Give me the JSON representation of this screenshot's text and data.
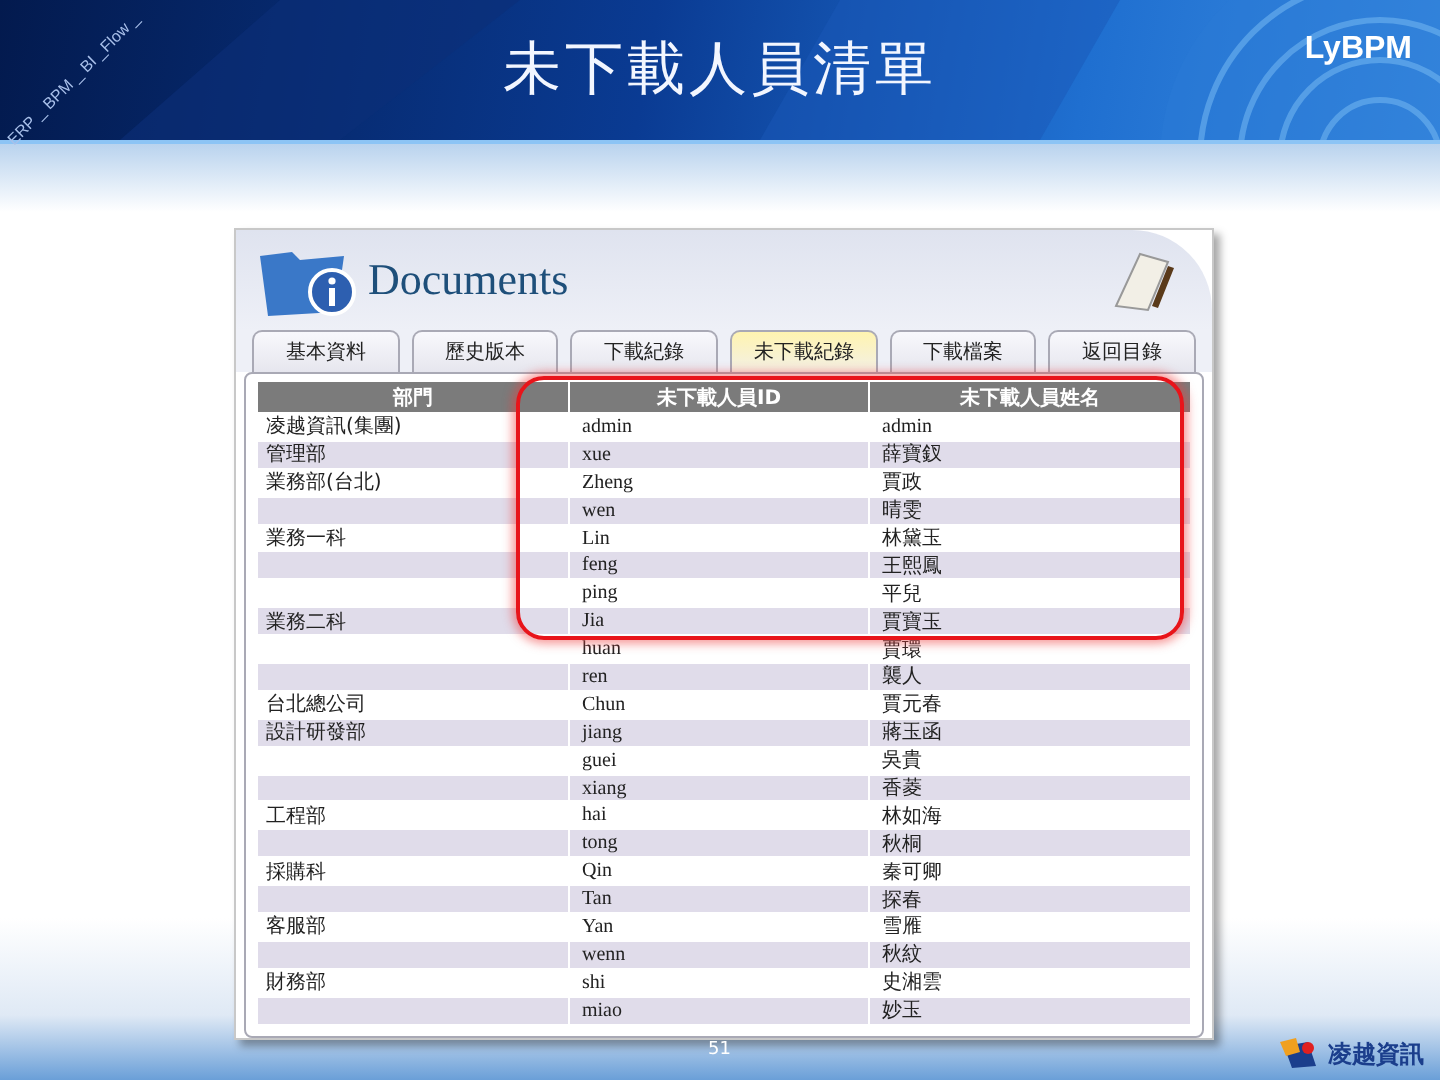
{
  "slide": {
    "title": "未下載人員清單",
    "brand": "LyBPM",
    "watermark_text": "ERP _ BPM _ BI _Flow _",
    "page_number": "51",
    "footer_logo": "凌越資訊"
  },
  "app": {
    "title": "Documents",
    "tabs": [
      {
        "label": "基本資料",
        "selected": false
      },
      {
        "label": "歷史版本",
        "selected": false
      },
      {
        "label": "下載紀錄",
        "selected": false
      },
      {
        "label": "未下載紀錄",
        "selected": true
      },
      {
        "label": "下載檔案",
        "selected": false
      },
      {
        "label": "返回目錄",
        "selected": false
      }
    ],
    "table": {
      "columns": [
        "部門",
        "未下載人員ID",
        "未下載人員姓名"
      ],
      "rows": [
        [
          "凌越資訊(集團)",
          "admin",
          "admin"
        ],
        [
          "管理部",
          "xue",
          "薛寶釵"
        ],
        [
          "業務部(台北)",
          "Zheng",
          "賈政"
        ],
        [
          "",
          "wen",
          "晴雯"
        ],
        [
          "業務一科",
          "Lin",
          "林黛玉"
        ],
        [
          "",
          "feng",
          "王熙鳳"
        ],
        [
          "",
          "ping",
          "平兒"
        ],
        [
          "業務二科",
          "Jia",
          "賈寶玉"
        ],
        [
          "",
          "huan",
          "賈環"
        ],
        [
          "",
          "ren",
          "襲人"
        ],
        [
          "台北總公司",
          "Chun",
          "賈元春"
        ],
        [
          "設計研發部",
          "jiang",
          "蔣玉函"
        ],
        [
          "",
          "guei",
          "吳貴"
        ],
        [
          "",
          "xiang",
          "香菱"
        ],
        [
          "工程部",
          "hai",
          "林如海"
        ],
        [
          "",
          "tong",
          "秋桐"
        ],
        [
          "採購科",
          "Qin",
          "秦可卿"
        ],
        [
          "",
          "Tan",
          "探春"
        ],
        [
          "客服部",
          "Yan",
          "雪雁"
        ],
        [
          "",
          "wenn",
          "秋紋"
        ],
        [
          "財務部",
          "shi",
          "史湘雲"
        ],
        [
          "",
          "miao",
          "妙玉"
        ]
      ]
    }
  }
}
